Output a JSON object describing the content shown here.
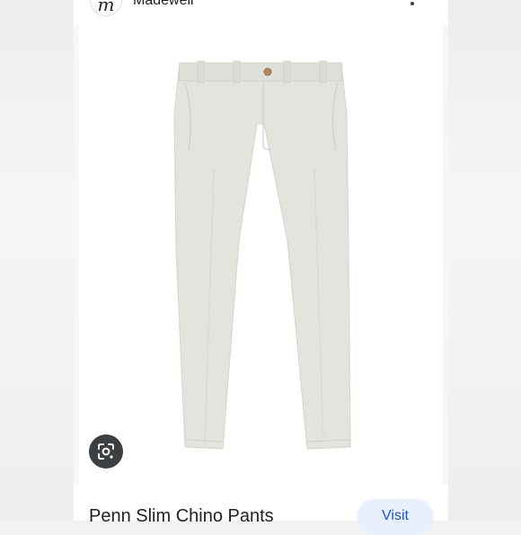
{
  "header": {
    "source_name": "Madewell",
    "avatar_glyph": "m",
    "more_icon": "more-vert-icon"
  },
  "image": {
    "alt_subject": "light grey chino pants",
    "lens_icon": "lens-icon"
  },
  "product": {
    "title": "Penn Slim Chino Pants",
    "visit_label": "Visit"
  },
  "colors": {
    "visit_bg": "#e8f0fe",
    "visit_text": "#1a56c4",
    "lens_bg": "#3c4043",
    "pants": "#e4e4df"
  }
}
